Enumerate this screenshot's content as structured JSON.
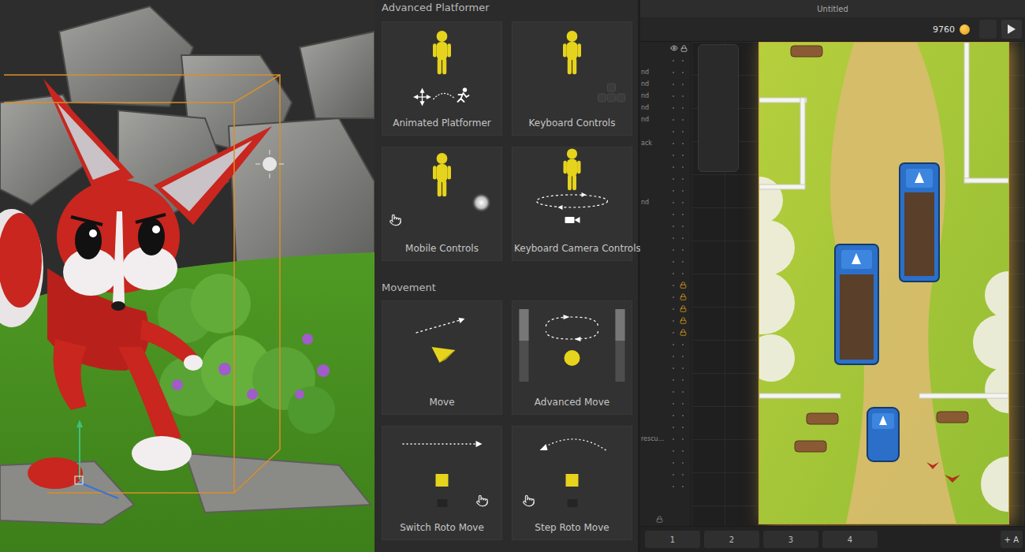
{
  "library": {
    "sections": [
      {
        "title": "Advanced Platformer",
        "cards": [
          {
            "title": "Animated Platformer"
          },
          {
            "title": "Keyboard Controls"
          },
          {
            "title": "Mobile Controls"
          },
          {
            "title": "Keyboard Camera Controls"
          }
        ]
      },
      {
        "title": "Movement",
        "cards": [
          {
            "title": "Move"
          },
          {
            "title": "Advanced Move"
          },
          {
            "title": "Switch Roto Move"
          },
          {
            "title": "Step Roto Move"
          }
        ]
      }
    ]
  },
  "editor": {
    "window": {
      "title": "Untitled"
    },
    "toolbar": {
      "coins": "9760"
    },
    "layers": [
      {
        "label": "",
        "locked": false
      },
      {
        "label": "nd",
        "locked": false
      },
      {
        "label": "nd",
        "locked": false
      },
      {
        "label": "nd",
        "locked": false
      },
      {
        "label": "nd",
        "locked": false
      },
      {
        "label": "nd",
        "locked": false
      },
      {
        "label": "",
        "locked": false
      },
      {
        "label": "ack",
        "locked": false
      },
      {
        "label": "",
        "locked": false
      },
      {
        "label": "",
        "locked": false
      },
      {
        "label": "",
        "locked": false
      },
      {
        "label": "",
        "locked": false
      },
      {
        "label": "nd",
        "locked": false
      },
      {
        "label": "",
        "locked": false
      },
      {
        "label": "",
        "locked": false
      },
      {
        "label": "",
        "locked": false
      },
      {
        "label": "",
        "locked": false
      },
      {
        "label": "",
        "locked": false
      },
      {
        "label": "",
        "locked": false
      },
      {
        "label": "",
        "locked": true
      },
      {
        "label": "",
        "locked": true
      },
      {
        "label": "",
        "locked": true
      },
      {
        "label": "",
        "locked": true
      },
      {
        "label": "",
        "locked": true
      },
      {
        "label": "",
        "locked": false
      },
      {
        "label": "",
        "locked": false
      },
      {
        "label": "",
        "locked": false
      },
      {
        "label": "",
        "locked": false
      },
      {
        "label": "",
        "locked": false
      },
      {
        "label": "",
        "locked": false
      },
      {
        "label": "",
        "locked": false
      },
      {
        "label": "",
        "locked": false
      },
      {
        "label": "rescu...",
        "locked": false
      },
      {
        "label": "",
        "locked": false
      },
      {
        "label": "",
        "locked": false
      },
      {
        "label": "",
        "locked": false
      },
      {
        "label": "",
        "locked": false
      }
    ],
    "tabs": [
      {
        "label": "1",
        "selected": false
      },
      {
        "label": "2",
        "selected": false
      },
      {
        "label": "3",
        "selected": false
      },
      {
        "label": "4",
        "selected": false
      }
    ],
    "add_button": "+ A"
  }
}
